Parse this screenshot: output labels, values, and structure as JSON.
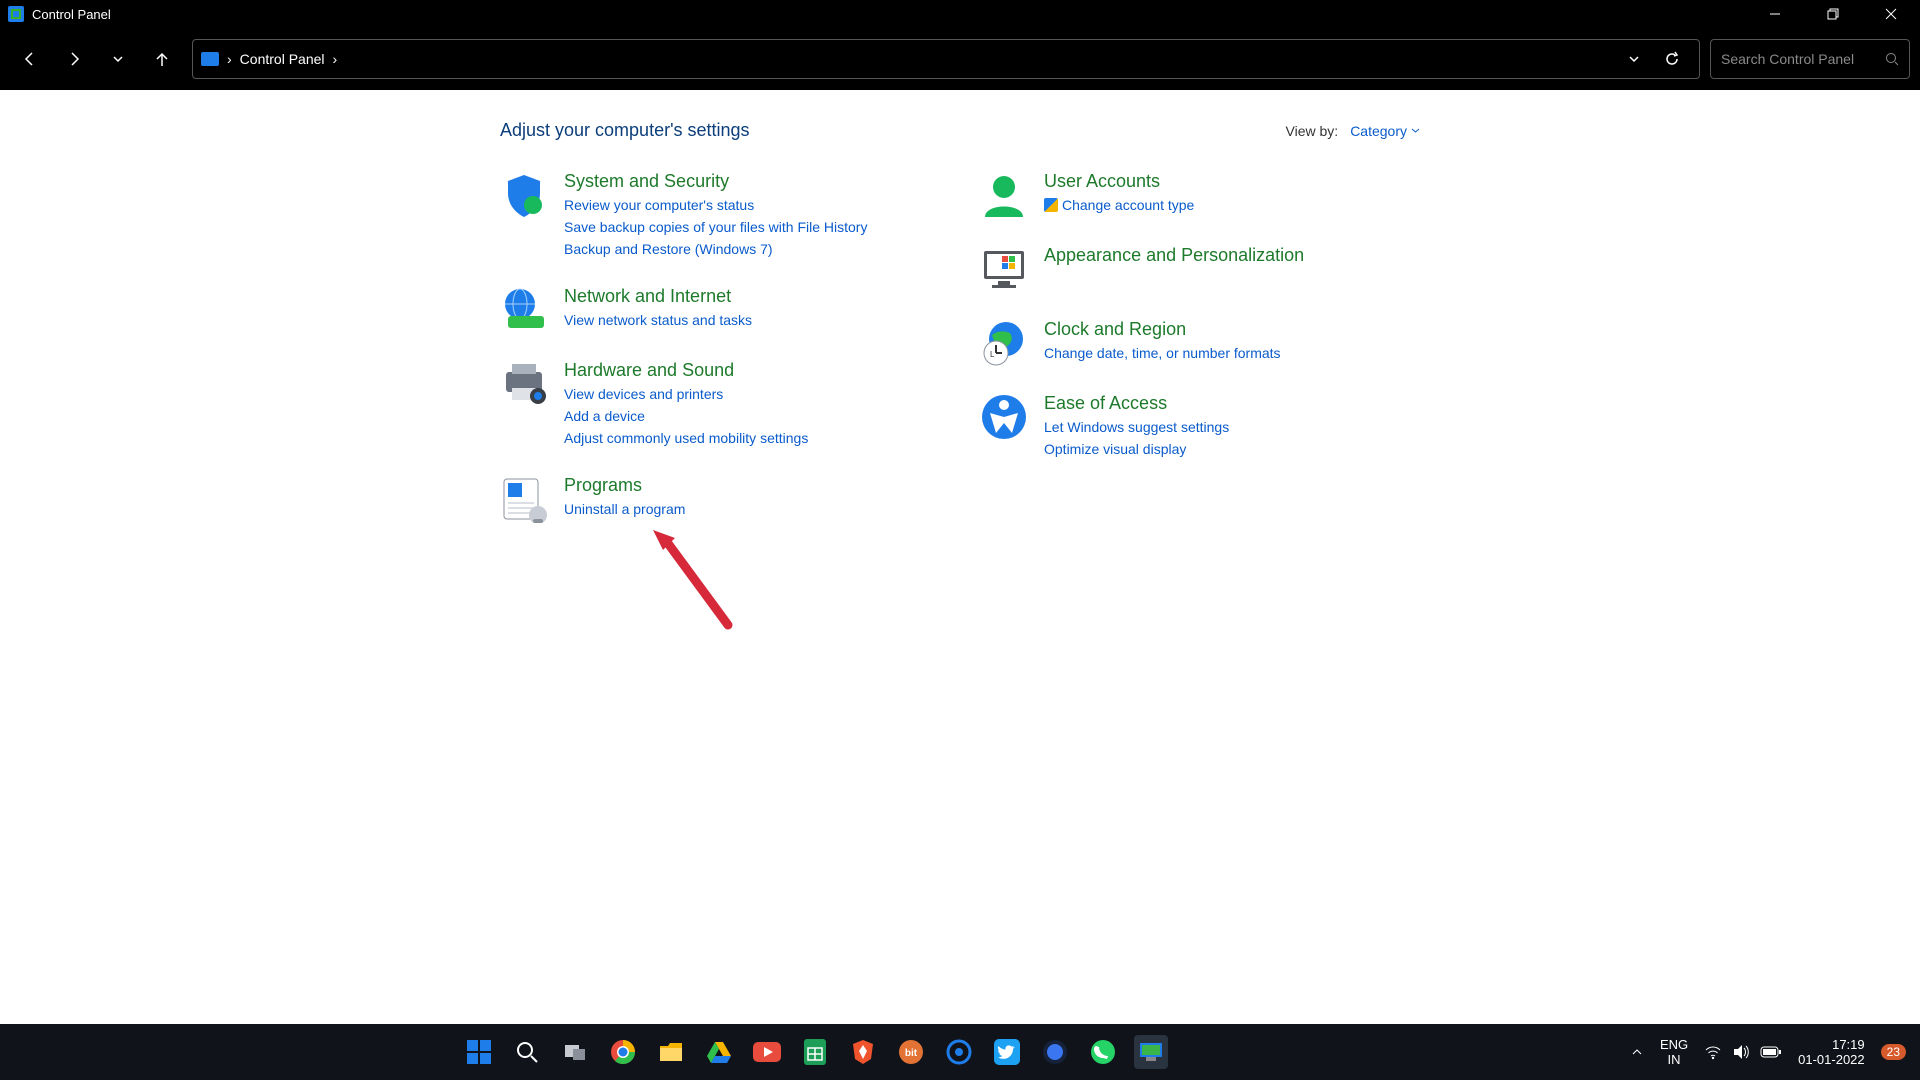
{
  "window": {
    "title": "Control Panel"
  },
  "breadcrumb": {
    "root": "Control Panel"
  },
  "search": {
    "placeholder": "Search Control Panel"
  },
  "page": {
    "title": "Adjust your computer's settings",
    "viewby_label": "View by:",
    "viewby_value": "Category"
  },
  "left": {
    "system": {
      "title": "System and Security",
      "links": [
        "Review your computer's status",
        "Save backup copies of your files with File History",
        "Backup and Restore (Windows 7)"
      ]
    },
    "network": {
      "title": "Network and Internet",
      "links": [
        "View network status and tasks"
      ]
    },
    "hardware": {
      "title": "Hardware and Sound",
      "links": [
        "View devices and printers",
        "Add a device",
        "Adjust commonly used mobility settings"
      ]
    },
    "programs": {
      "title": "Programs",
      "links": [
        "Uninstall a program"
      ]
    }
  },
  "right": {
    "users": {
      "title": "User Accounts",
      "links": [
        "Change account type"
      ]
    },
    "appearance": {
      "title": "Appearance and Personalization"
    },
    "clock": {
      "title": "Clock and Region",
      "links": [
        "Change date, time, or number formats"
      ]
    },
    "ease": {
      "title": "Ease of Access",
      "links": [
        "Let Windows suggest settings",
        "Optimize visual display"
      ]
    }
  },
  "taskbar": {
    "lang1": "ENG",
    "lang2": "IN",
    "time": "17:19",
    "date": "01-01-2022",
    "badge": "23"
  }
}
